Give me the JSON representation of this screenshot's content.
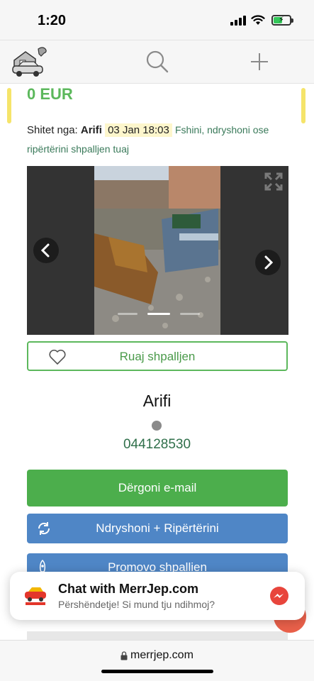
{
  "status_bar": {
    "time": "1:20"
  },
  "header": {
    "logo_icon": "merrjep-logo-icon",
    "search_icon": "search-icon",
    "add_icon": "plus-icon"
  },
  "listing": {
    "price": "0 EUR",
    "seller_prefix": "Shitet nga:",
    "seller_name": "Arifi",
    "date": "03 Jan 18:03",
    "edit_link": "Fshini, ndryshoni ose ripërtërini shpalljen tuaj",
    "gallery": {
      "expand_icon": "fullscreen-icon",
      "prev_icon": "chevron-left-icon",
      "next_icon": "chevron-right-icon",
      "slide_count": 3,
      "active_slide": 2
    },
    "save_label": "Ruaj shpalljen"
  },
  "contact": {
    "name": "Arifi",
    "phone": "044128530",
    "email_button": "Dërgoni e-mail",
    "edit_button": "Ndryshoni + Ripërtërini",
    "promo_button": "Promovo shpallien"
  },
  "chat": {
    "title": "Chat with MerrJep.com",
    "subtitle": "Përshëndetje! Si mund tju ndihmoj?",
    "icon": "messenger-icon"
  },
  "browser": {
    "url": "merrjep.com"
  },
  "colors": {
    "green": "#5cb85c",
    "blue": "#4f86c6",
    "accent_yellow": "#f5e46a",
    "fab": "#e9604a"
  }
}
